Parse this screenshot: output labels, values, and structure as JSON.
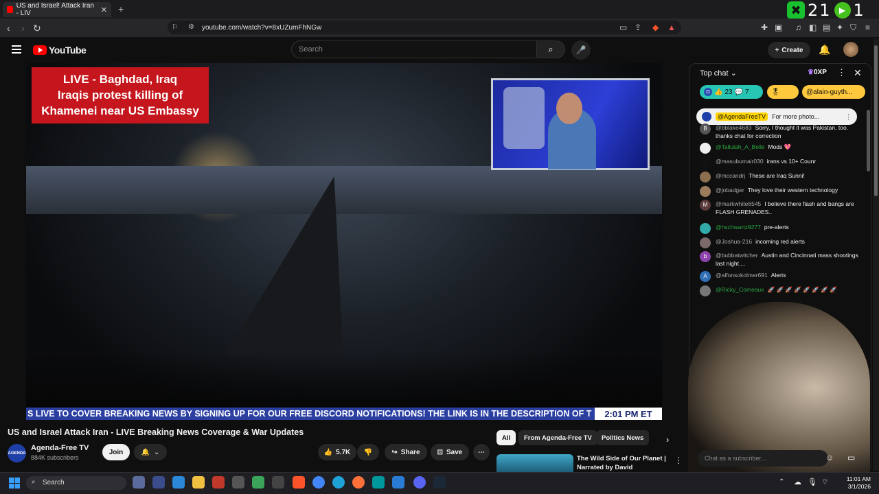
{
  "browser": {
    "tab_title": "US and Israel! Attack Iran - LIV",
    "tab_close": "✕",
    "new_tab": "+",
    "url": "youtube.com/watch?v=8xUZumFhNGw",
    "hud_count": "21",
    "hud_right": "1"
  },
  "youtube": {
    "logo_text": "YouTube",
    "search_placeholder": "Search",
    "create_label": "Create"
  },
  "video": {
    "banner_line1": "LIVE - Baghdad, Iraq",
    "banner_line2": "Iraqis protest killing of",
    "banner_line3": "Khamenei near US Embassy",
    "ticker_text": "S LIVE TO COVER BREAKING NEWS BY SIGNING UP FOR OUR FREE DISCORD NOTIFICATIONS! THE LINK IS IN THE DESCRIPTION OF T",
    "ticker_time": "2:01 PM ET",
    "title": "US and Israel Attack Iran - LIVE Breaking News Coverage & War Updates",
    "channel": "Agenda-Free TV",
    "subscribers": "884K subscribers",
    "join_label": "Join",
    "likes": "5.7K",
    "share_label": "Share",
    "save_label": "Save"
  },
  "recommendations": {
    "filters": [
      "All",
      "From Agenda-Free TV",
      "Politics News"
    ],
    "first_title": "The Wild Side of Our Planet | Narrated by David Attenborou..."
  },
  "chat": {
    "header": "Top chat",
    "xp": "0XP",
    "badge_likes": "23",
    "badge_comments": "7",
    "badge_user": "@alain-guyth...",
    "pinned_user": "@AgendaFreeTV",
    "pinned_text": "For more photo...",
    "messages": [
      {
        "user": "@bblake4683",
        "text": "Sorry, I thought it was Pakistan, too. thanks chat for correction",
        "initial": "B"
      },
      {
        "user": "@Tallulah_A_Belle",
        "text": "Mods 💖",
        "initial": ""
      },
      {
        "user": "@masubumair030",
        "text": "irans vs 10+ Counr",
        "initial": ""
      },
      {
        "user": "@mccandrj",
        "text": "These are Iraq Sunni!",
        "initial": ""
      },
      {
        "user": "@jobadger",
        "text": "They love their western technology",
        "initial": ""
      },
      {
        "user": "@markwhite6545",
        "text": "I believe there flash and bangs are FLASH GRENADES..",
        "initial": "M"
      },
      {
        "user": "@hschwartz9277",
        "text": "pre-alerts",
        "initial": ""
      },
      {
        "user": "@Joshua-216",
        "text": "incoming red alerts",
        "initial": ""
      },
      {
        "user": "@bubbatwitcher",
        "text": "Austin and Cincinnati mass shootings last night....",
        "initial": "b"
      },
      {
        "user": "@alfonsokolmer691",
        "text": "Alerts",
        "initial": "A"
      },
      {
        "user": "@Ricky_Comeaux",
        "text": "🚀 🚀 🚀 🚀 🚀 🚀 🚀 🚀",
        "initial": ""
      }
    ],
    "input_placeholder": "Chat as a subscriber..."
  },
  "taskbar": {
    "search_label": "Search",
    "time": "11:01 AM",
    "date": "3/1/2026"
  }
}
